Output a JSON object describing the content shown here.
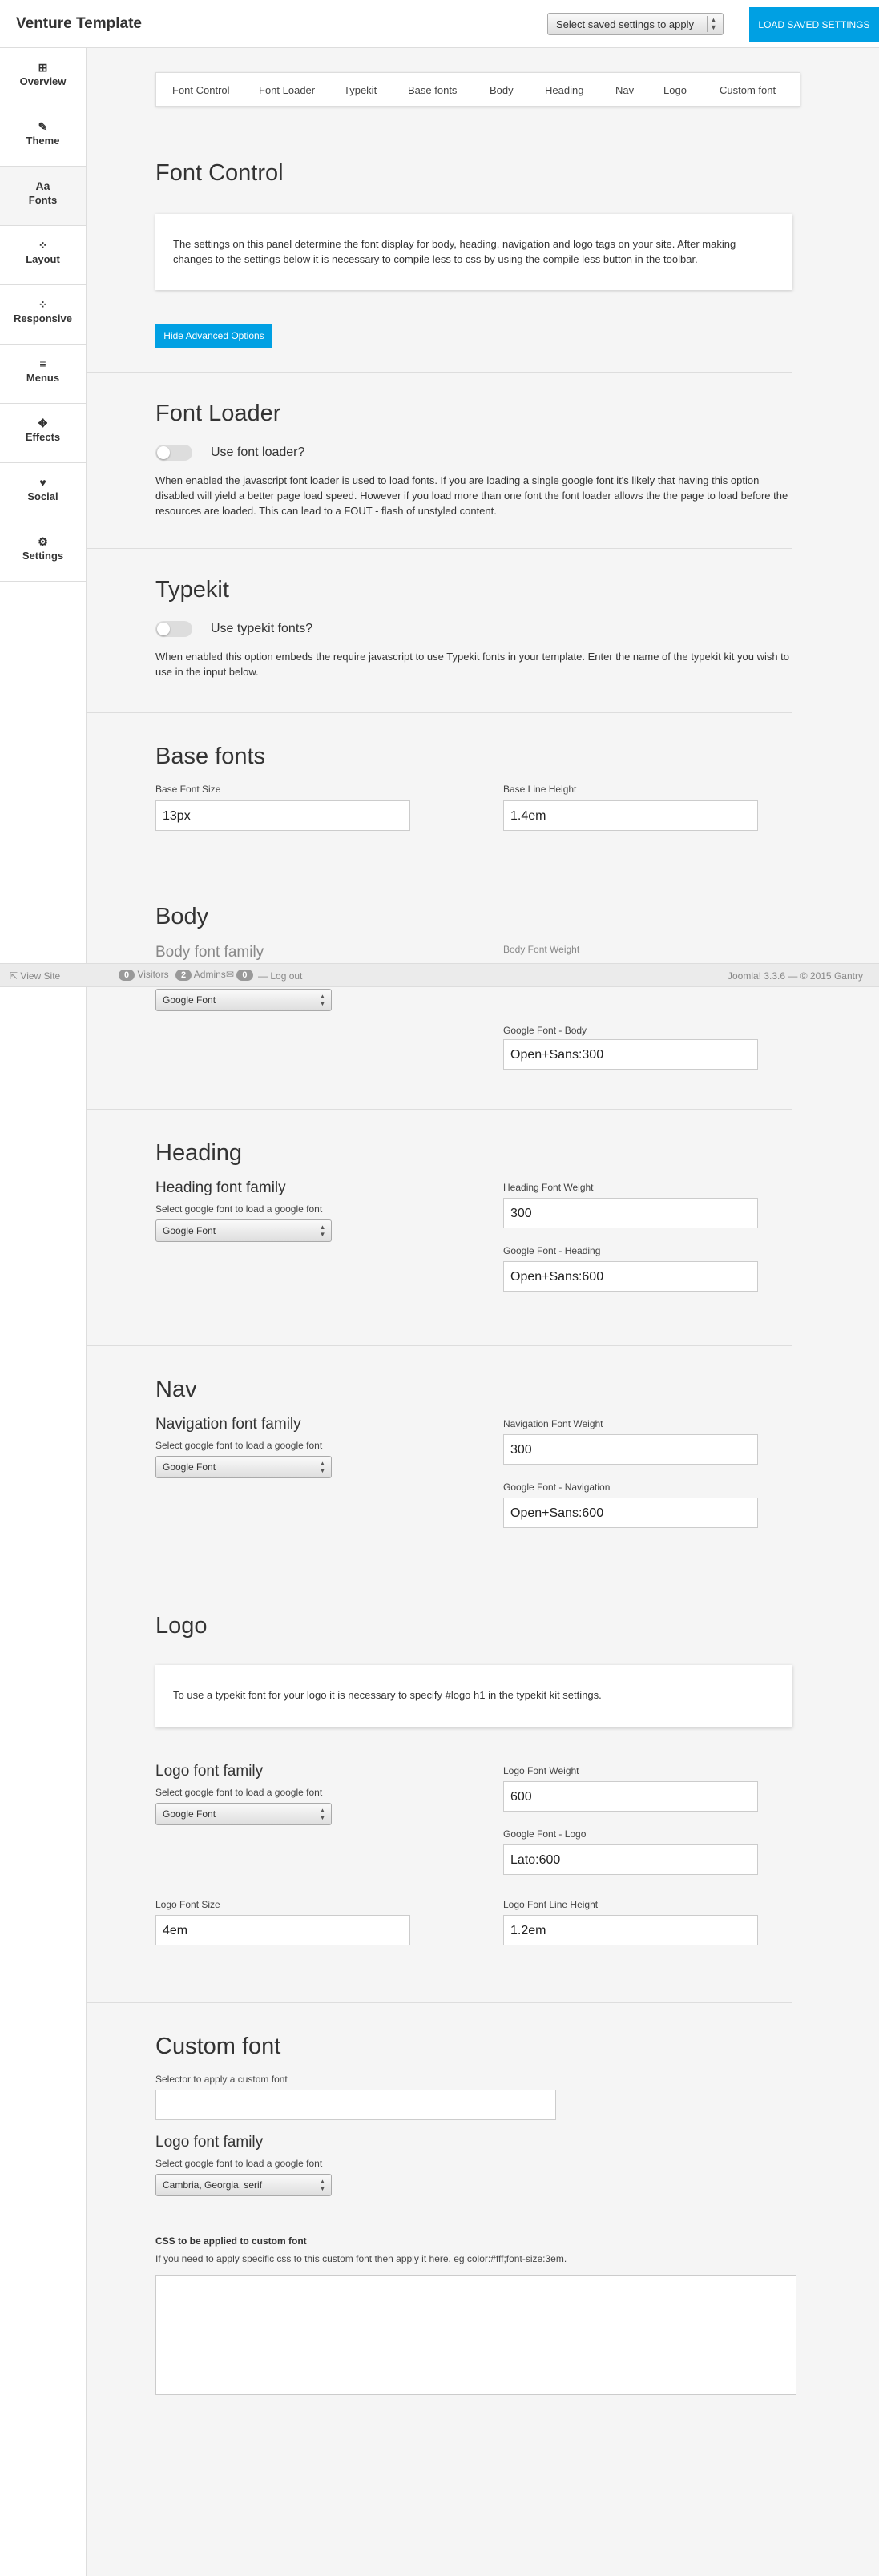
{
  "header": {
    "title": "Venture Template",
    "saved_settings_placeholder": "Select saved settings to apply",
    "load_button": "LOAD SAVED SETTINGS"
  },
  "sidebar": {
    "items": [
      {
        "label": "Overview",
        "icon": "book-icon",
        "glyph": "⊞"
      },
      {
        "label": "Theme",
        "icon": "brush-icon",
        "glyph": "✎"
      },
      {
        "label": "Fonts",
        "icon": "font-icon",
        "glyph": "Aa"
      },
      {
        "label": "Layout",
        "icon": "grid-icon",
        "glyph": "⁘"
      },
      {
        "label": "Responsive",
        "icon": "grid-icon",
        "glyph": "⁘"
      },
      {
        "label": "Menus",
        "icon": "menu-icon",
        "glyph": "≡"
      },
      {
        "label": "Effects",
        "icon": "magic-icon",
        "glyph": "✥"
      },
      {
        "label": "Social",
        "icon": "twitter-icon",
        "glyph": "♥"
      },
      {
        "label": "Settings",
        "icon": "gear-icon",
        "glyph": "⚙"
      }
    ]
  },
  "tabs": [
    "Font Control",
    "Font Loader",
    "Typekit",
    "Base fonts",
    "Body",
    "Heading",
    "Nav",
    "Logo",
    "Custom font"
  ],
  "font_control": {
    "title": "Font Control",
    "info": "The settings on this panel determine the font display for body, heading, navigation and logo tags on your site. After making changes to the settings below it is necessary to compile less to css by using the compile less button in the toolbar.",
    "advanced_button": "Hide Advanced Options"
  },
  "font_loader": {
    "title": "Font Loader",
    "toggle_label": "Use font loader?",
    "desc": "When enabled the javascript font loader is used to load fonts. If you are loading a single google font it's likely that having this option disabled will yield a better page load speed. However if you load more than one font the font loader allows the the page to load before the resources are loaded. This can lead to a FOUT - flash of unstyled content."
  },
  "typekit": {
    "title": "Typekit",
    "toggle_label": "Use typekit fonts?",
    "desc": "When enabled this option embeds the require javascript to use Typekit fonts in your template. Enter the name of the typekit kit you wish to use in the input below."
  },
  "base_fonts": {
    "title": "Base fonts",
    "size_label": "Base Font Size",
    "size_value": "13px",
    "line_height_label": "Base Line Height",
    "line_height_value": "1.4em"
  },
  "body": {
    "title": "Body",
    "family_title": "Body font family",
    "select_value": "Google Font",
    "weight_label": "Body Font Weight",
    "google_label": "Google Font - Body",
    "google_value": "Open+Sans:300"
  },
  "heading": {
    "title": "Heading",
    "family_title": "Heading font family",
    "select_hint": "Select google font to load a google font",
    "select_value": "Google Font",
    "weight_label": "Heading Font Weight",
    "weight_value": "300",
    "google_label": "Google Font - Heading",
    "google_value": "Open+Sans:600"
  },
  "nav": {
    "title": "Nav",
    "family_title": "Navigation font family",
    "select_hint": "Select google font to load a google font",
    "select_value": "Google Font",
    "weight_label": "Navigation Font Weight",
    "weight_value": "300",
    "google_label": "Google Font - Navigation",
    "google_value": "Open+Sans:600"
  },
  "logo": {
    "title": "Logo",
    "info": "To use a typekit font for your logo it is necessary to specify #logo h1 in the typekit kit settings.",
    "family_title": "Logo font family",
    "select_hint": "Select google font to load a google font",
    "select_value": "Google Font",
    "weight_label": "Logo Font Weight",
    "weight_value": "600",
    "google_label": "Google Font - Logo",
    "google_value": "Lato:600",
    "size_label": "Logo Font Size",
    "size_value": "4em",
    "line_height_label": "Logo Font Line Height",
    "line_height_value": "1.2em"
  },
  "custom_font": {
    "title": "Custom font",
    "selector_label": "Selector to apply a custom font",
    "family_title": "Logo font family",
    "select_hint": "Select google font to load a google font",
    "select_value": "Cambria, Georgia, serif",
    "css_title": "CSS to be applied to custom font",
    "css_hint": "If you need to apply specific css to this custom font then apply it here. eg color:#fff;font-size:3em."
  },
  "statusbar": {
    "view_site": "View Site",
    "visitors_count": "0",
    "visitors_label": "Visitors",
    "admins_count": "2",
    "admins_label": "Admins",
    "messages_count": "0",
    "logout": "Log out",
    "version": "Joomla! 3.3.6",
    "copyright": "© 2015 Gantry"
  }
}
